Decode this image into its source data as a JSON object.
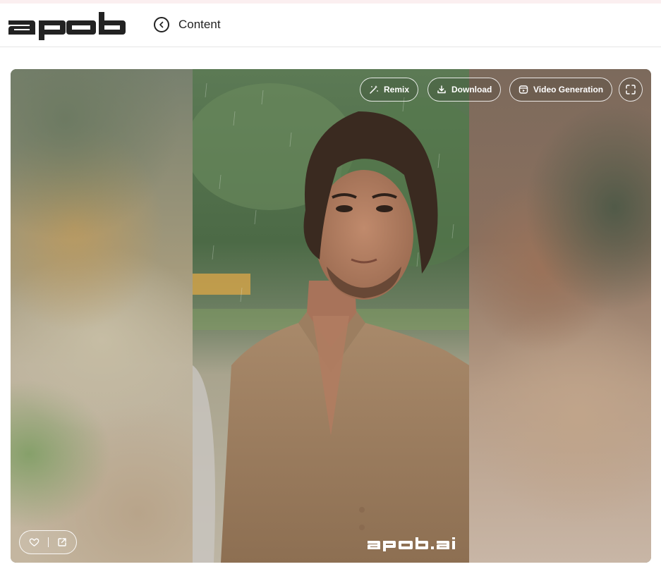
{
  "header": {
    "logo_text": "apob",
    "back_icon": "chevron-left-circle-icon",
    "back_label": "Content"
  },
  "viewer": {
    "toolbar": {
      "remix_label": "Remix",
      "remix_icon": "magic-wand-icon",
      "download_label": "Download",
      "download_icon": "download-icon",
      "video_label": "Video Generation",
      "video_icon": "video-camera-icon",
      "fullscreen_icon": "fullscreen-icon"
    },
    "actions": {
      "like_icon": "heart-icon",
      "share_icon": "share-icon"
    },
    "watermark_text": "apob.ai"
  },
  "colors": {
    "header_border": "#e6e6e6",
    "top_strip": "#fbeff0",
    "text": "#222222",
    "overlay_text": "#ffffff"
  }
}
